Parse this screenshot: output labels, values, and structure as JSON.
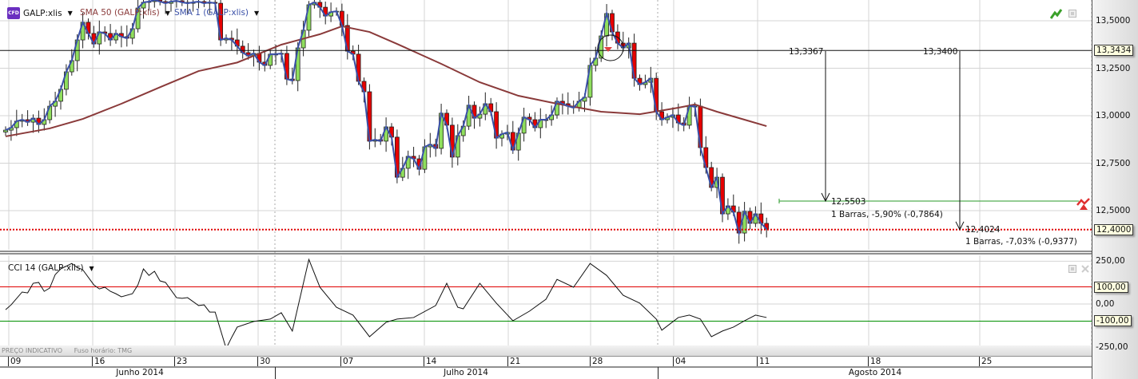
{
  "legend": {
    "instrument_badge": "CFD",
    "instrument": "GALP:xlis",
    "sma50": "SMA 50 (GALP:xlis)",
    "sma1": "SMA 1 (GALP:xlis)",
    "cci": "CCI 14 (GALP:xlis)"
  },
  "colors": {
    "up": "#8fde5d",
    "down": "#e60000",
    "sma1": "#3a50a8",
    "sma50": "#8a3a3a",
    "cci": "#111111",
    "cci_upper": "#e00000",
    "cci_lower": "#009000",
    "support": "#2a9a2a",
    "last_price": "#e00000"
  },
  "footer": {
    "indicative": "PREÇO INDICATIVO",
    "timezone": "Fuso horário: TMG"
  },
  "price_axis": {
    "ticks": [
      "13,5000",
      "13,2500",
      "13,0000",
      "12,7500",
      "12,5000"
    ],
    "tick_values": [
      13.5,
      13.25,
      13.0,
      12.75,
      12.5
    ],
    "hline_tag": "13,3434",
    "last_price_tag": "12,4000"
  },
  "cci_axis": {
    "ticks": [
      "250,00",
      "0,00",
      "-250,00"
    ],
    "tick_values": [
      250,
      0,
      -250
    ],
    "upper_tag": "100,00",
    "lower_tag": "-100,00",
    "upper": 100,
    "lower": -100
  },
  "date_axis": {
    "days": [
      "09",
      "16",
      "23",
      "30",
      "07",
      "14",
      "21",
      "28",
      "04",
      "11",
      "18",
      "25"
    ],
    "months": [
      "Junho 2014",
      "Julho 2014",
      "Agosto 2014"
    ]
  },
  "annotations": {
    "hline_value": 13.3434,
    "last_price": 12.4,
    "support_value": 12.5503,
    "arrow1": {
      "from": "13,3367",
      "to": "12,5503",
      "stats": "1 Barras, -5,90% (-0,7864)"
    },
    "arrow2": {
      "from": "13,3400",
      "to": "12,4024",
      "stats": "1 Barras, -7,03% (-0,9377)"
    }
  },
  "chart_data": {
    "type": "candlestick",
    "series": [
      {
        "name": "GALP:xlis",
        "close": [
          12.924,
          12.937,
          12.971,
          12.979,
          12.966,
          12.987,
          12.954,
          12.979,
          13.05,
          13.076,
          13.139,
          13.231,
          13.29,
          13.399,
          13.492,
          13.433,
          13.378,
          13.441,
          13.433,
          13.399,
          13.433,
          13.416,
          13.408,
          13.458,
          13.567,
          13.597,
          13.601,
          13.609,
          13.601,
          13.592,
          13.601,
          13.605,
          13.597,
          13.592,
          13.597,
          13.601,
          13.592,
          13.597,
          13.592,
          13.399,
          13.408,
          13.399,
          13.366,
          13.332,
          13.315,
          13.328,
          13.282,
          13.265,
          13.324,
          13.324,
          13.328,
          13.193,
          13.185,
          13.357,
          13.45,
          13.584,
          13.597,
          13.571,
          13.525,
          13.546,
          13.55,
          13.475,
          13.34,
          13.324,
          13.181,
          13.126,
          12.866,
          12.874,
          12.866,
          12.941,
          12.887,
          12.676,
          12.723,
          12.786,
          12.773,
          12.718,
          12.836,
          12.849,
          12.828,
          13.013,
          12.95,
          12.782,
          12.895,
          12.945,
          13.055,
          12.987,
          13.008,
          13.063,
          13.021,
          12.882,
          12.903,
          12.912,
          12.819,
          12.908,
          12.992,
          12.979,
          12.937,
          12.979,
          12.979,
          13.004,
          13.076,
          13.063,
          13.05,
          13.042,
          13.076,
          13.097,
          13.265,
          13.303,
          13.42,
          13.538,
          13.441,
          13.382,
          13.357,
          13.382,
          13.197,
          13.164,
          13.176,
          13.197,
          13.021,
          12.979,
          12.992,
          13.004,
          12.962,
          12.95,
          13.05,
          13.05,
          12.832,
          12.727,
          12.622,
          12.676,
          12.483,
          12.525,
          12.492,
          12.382,
          12.496,
          12.433,
          12.483,
          12.433,
          12.403
        ]
      },
      {
        "name": "SMA 50 (GALP:xlis)",
        "points": [
          [
            0,
            12.891
          ],
          [
            8,
            12.933
          ],
          [
            14,
            12.983
          ],
          [
            21,
            13.063
          ],
          [
            28,
            13.15
          ],
          [
            35,
            13.235
          ],
          [
            42,
            13.28
          ],
          [
            50,
            13.374
          ],
          [
            57,
            13.429
          ],
          [
            61,
            13.471
          ],
          [
            66,
            13.441
          ],
          [
            71,
            13.378
          ],
          [
            79,
            13.273
          ],
          [
            86,
            13.176
          ],
          [
            93,
            13.105
          ],
          [
            100,
            13.063
          ],
          [
            108,
            13.021
          ],
          [
            115,
            13.008
          ],
          [
            122,
            13.042
          ],
          [
            125,
            13.059
          ],
          [
            129,
            13.021
          ],
          [
            134,
            12.979
          ],
          [
            138,
            12.945
          ]
        ]
      },
      {
        "name": "CCI 14 (GALP:xlis)",
        "points": [
          [
            0,
            -33
          ],
          [
            1,
            -5
          ],
          [
            3,
            70
          ],
          [
            4,
            65
          ],
          [
            5,
            121
          ],
          [
            6,
            126
          ],
          [
            7,
            74
          ],
          [
            8,
            93
          ],
          [
            9,
            172
          ],
          [
            10,
            205
          ],
          [
            12,
            237
          ],
          [
            13,
            214
          ],
          [
            14,
            200
          ],
          [
            16,
            112
          ],
          [
            17,
            88
          ],
          [
            18,
            98
          ],
          [
            19,
            74
          ],
          [
            20,
            60
          ],
          [
            21,
            42
          ],
          [
            23,
            60
          ],
          [
            24,
            112
          ],
          [
            25,
            205
          ],
          [
            26,
            167
          ],
          [
            27,
            191
          ],
          [
            28,
            135
          ],
          [
            29,
            126
          ],
          [
            31,
            37
          ],
          [
            32,
            33
          ],
          [
            33,
            37
          ],
          [
            35,
            -9
          ],
          [
            36,
            -5
          ],
          [
            37,
            -47
          ],
          [
            38,
            -47
          ],
          [
            40,
            -260
          ],
          [
            41,
            -195
          ],
          [
            42,
            -135
          ],
          [
            45,
            -102
          ],
          [
            48,
            -88
          ],
          [
            50,
            -51
          ],
          [
            52,
            -158
          ],
          [
            55,
            260
          ],
          [
            57,
            98
          ],
          [
            60,
            -19
          ],
          [
            63,
            -65
          ],
          [
            66,
            -191
          ],
          [
            69,
            -107
          ],
          [
            71,
            -88
          ],
          [
            74,
            -79
          ],
          [
            78,
            -9
          ],
          [
            80,
            121
          ],
          [
            82,
            -19
          ],
          [
            83,
            -28
          ],
          [
            86,
            121
          ],
          [
            89,
            5
          ],
          [
            92,
            -98
          ],
          [
            95,
            -42
          ],
          [
            98,
            28
          ],
          [
            100,
            144
          ],
          [
            103,
            98
          ],
          [
            106,
            237
          ],
          [
            109,
            167
          ],
          [
            112,
            51
          ],
          [
            115,
            5
          ],
          [
            118,
            -88
          ],
          [
            119,
            -153
          ],
          [
            122,
            -79
          ],
          [
            124,
            -65
          ],
          [
            126,
            -88
          ],
          [
            128,
            -191
          ],
          [
            130,
            -158
          ],
          [
            132,
            -135
          ],
          [
            134,
            -98
          ],
          [
            136,
            -65
          ],
          [
            138,
            -79
          ]
        ]
      }
    ],
    "ylim": [
      12.3,
      13.6
    ],
    "cci_ylim": [
      -270,
      270
    ],
    "grid": true
  }
}
